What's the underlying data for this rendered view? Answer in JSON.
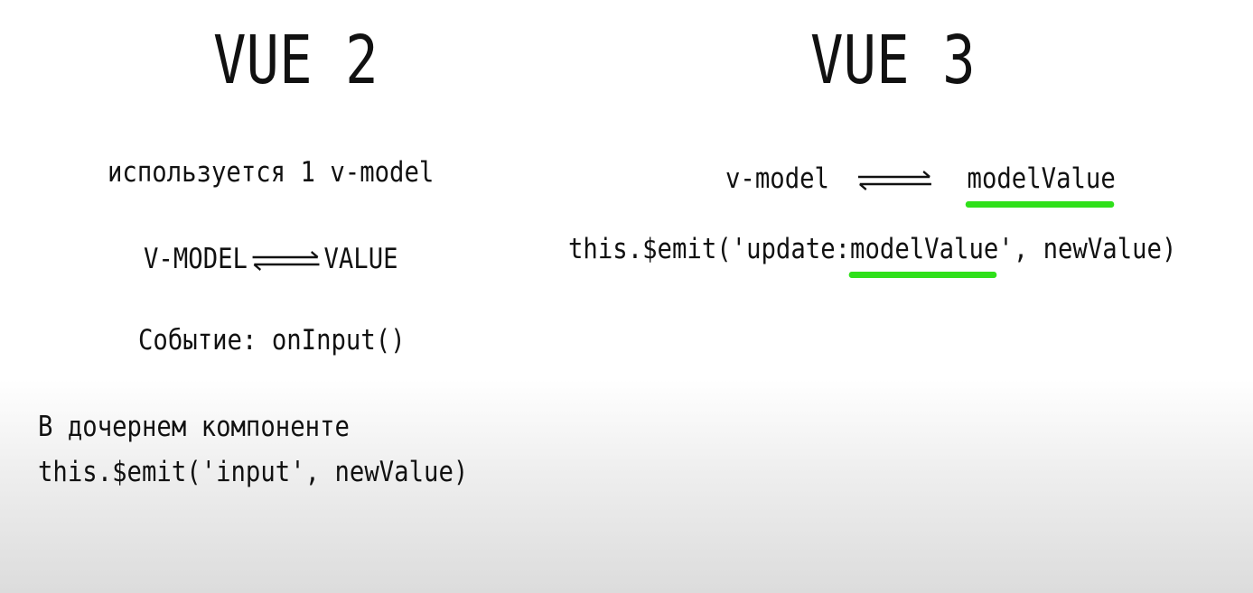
{
  "left": {
    "title": "VUE 2",
    "uses_line": "используется 1 v-model",
    "binding_left": "V-MODEL",
    "binding_right": "VALUE",
    "event_line": "Событие: onInput()",
    "child_line1": "В дочернем компоненте",
    "child_line2": "this.$emit('input', newValue)"
  },
  "right": {
    "title": "VUE 3",
    "binding_left": "v-model",
    "binding_right": "modelValue",
    "emit_prefix": "this.$emit('update:",
    "emit_highlight": "modelValue",
    "emit_suffix": "', newValue)"
  },
  "colors": {
    "highlight": "#2fe01a",
    "text": "#111111"
  },
  "icons": {
    "binding_arrow": "double-harpoon-arrow-icon"
  }
}
